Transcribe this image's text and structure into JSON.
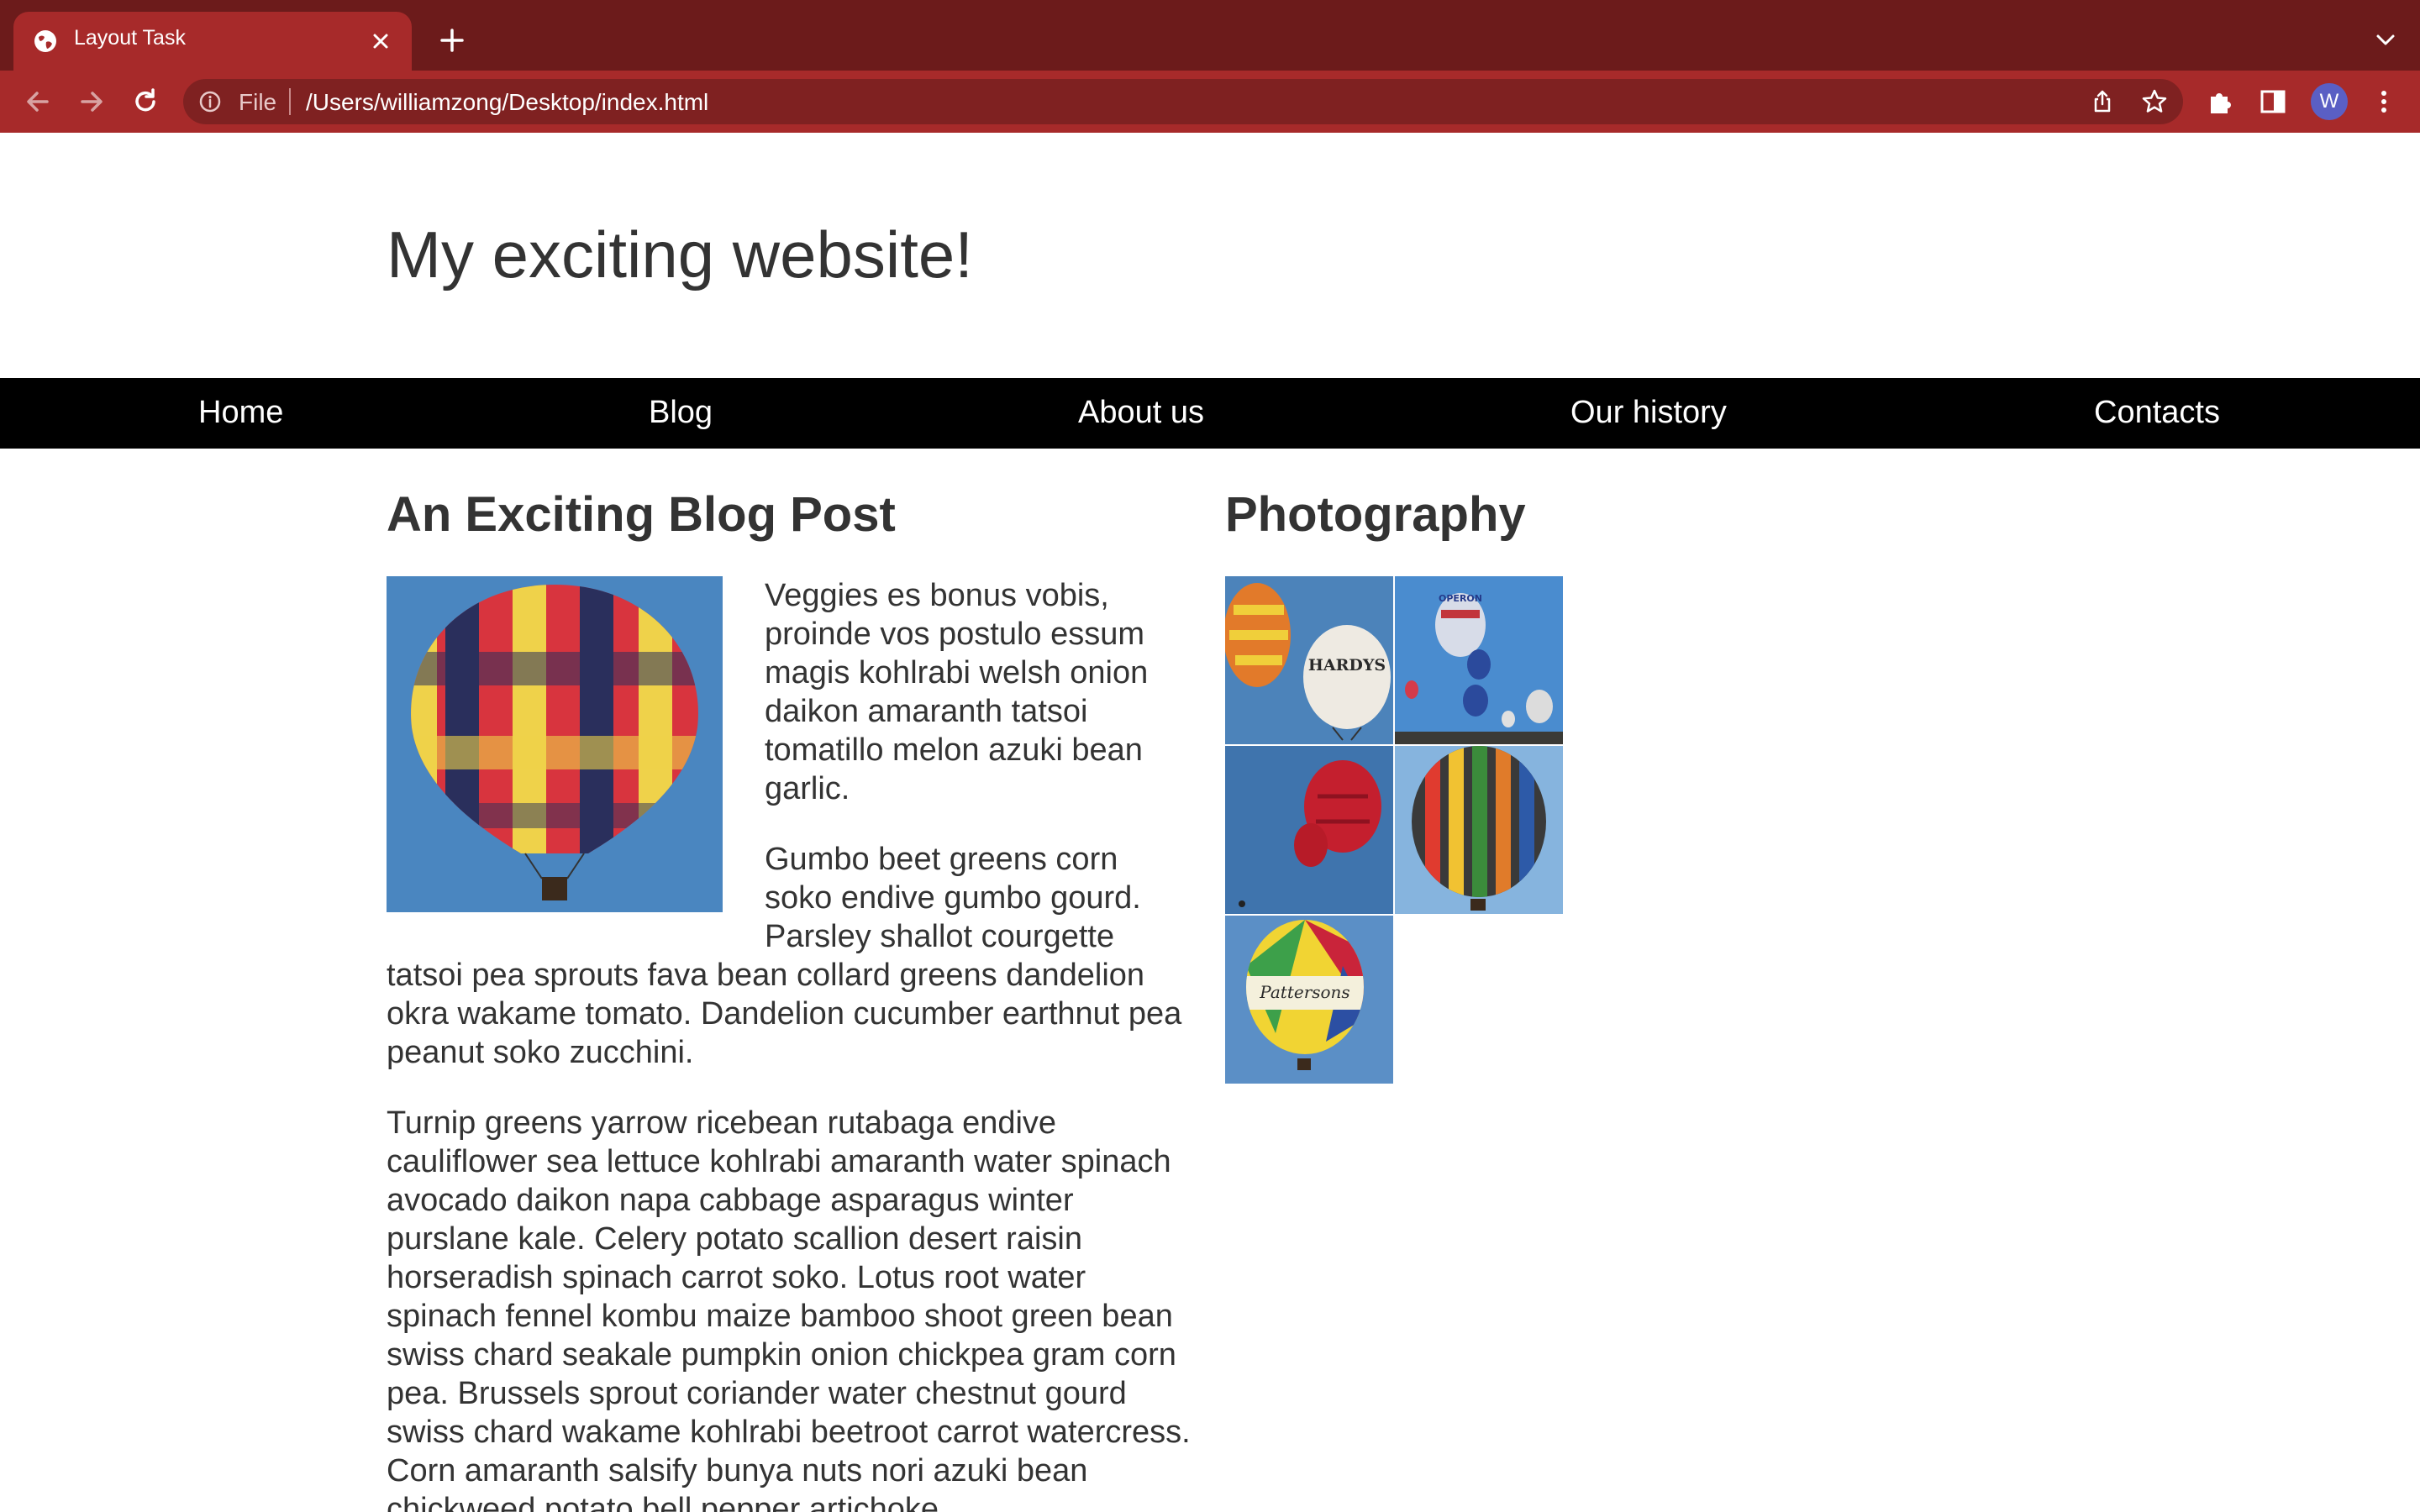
{
  "browser": {
    "tab_title": "Layout Task",
    "scheme": "File",
    "url": "/Users/williamzong/Desktop/index.html",
    "avatar_initial": "W",
    "accent": "#a72a2a",
    "frame_color": "#6c1b1b"
  },
  "site": {
    "title": "My exciting website!",
    "nav": [
      "Home",
      "Blog",
      "About us",
      "Our history",
      "Contacts"
    ]
  },
  "article": {
    "heading": "An Exciting Blog Post",
    "paragraphs": [
      "Veggies es bonus vobis, proinde vos postulo essum magis kohlrabi welsh onion daikon amaranth tatsoi tomatillo melon azuki bean garlic.",
      "Gumbo beet greens corn soko endive gumbo gourd. Parsley shallot courgette tatsoi pea sprouts fava bean collard greens dandelion okra wakame tomato. Dandelion cucumber earthnut pea peanut soko zucchini.",
      "Turnip greens yarrow ricebean rutabaga endive cauliflower sea lettuce kohlrabi amaranth water spinach avocado daikon napa cabbage asparagus winter purslane kale. Celery potato scallion desert raisin horseradish spinach carrot soko. Lotus root water spinach fennel kombu maize bamboo shoot green bean swiss chard seakale pumpkin onion chickpea gram corn pea. Brussels sprout coriander water chestnut gourd swiss chard wakame kohlrabi beetroot carrot watercress. Corn amaranth salsify bunya nuts nori azuki bean chickweed potato bell pepper artichoke."
    ]
  },
  "photography": {
    "heading": "Photography",
    "photos": [
      {
        "label": "HARDYS"
      },
      {
        "label": "OPERON"
      },
      {
        "label": ""
      },
      {
        "label": ""
      },
      {
        "label": "Pattersons"
      }
    ]
  }
}
